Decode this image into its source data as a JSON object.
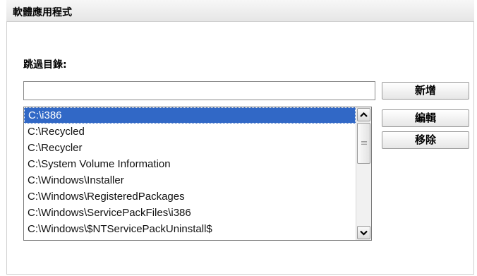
{
  "header": {
    "title": "軟體應用程式"
  },
  "skip_dirs": {
    "label": "跳過目錄:",
    "input_value": "",
    "items": [
      "C:\\i386",
      "C:\\Recycled",
      "C:\\Recycler",
      "C:\\System Volume Information",
      "C:\\Windows\\Installer",
      "C:\\Windows\\RegisteredPackages",
      "C:\\Windows\\ServicePackFiles\\i386",
      "C:\\Windows\\$NTServicePackUninstall$"
    ],
    "selected_index": 0
  },
  "buttons": {
    "add": "新增",
    "edit": "編輯",
    "remove": "移除"
  },
  "icons": {
    "scroll_up": "chevron-up-icon",
    "scroll_down": "chevron-down-icon"
  },
  "colors": {
    "selection": "#3168c6"
  }
}
